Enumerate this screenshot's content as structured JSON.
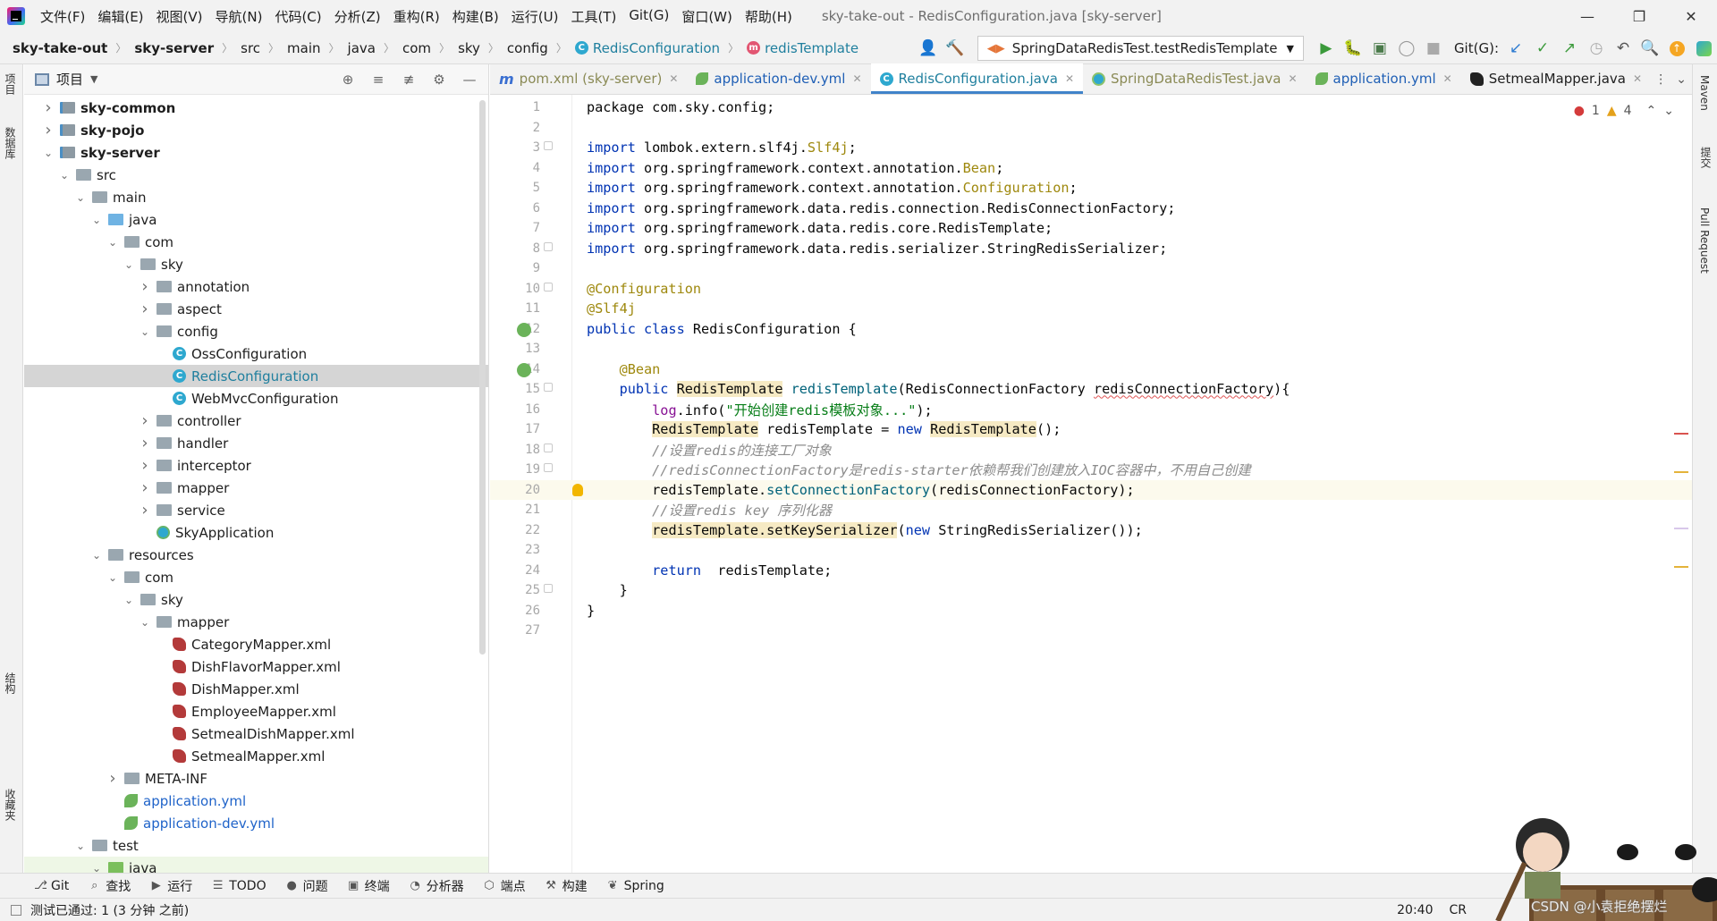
{
  "menubar": {
    "items": [
      "文件(F)",
      "编辑(E)",
      "视图(V)",
      "导航(N)",
      "代码(C)",
      "分析(Z)",
      "重构(R)",
      "构建(B)",
      "运行(U)",
      "工具(T)",
      "Git(G)",
      "窗口(W)",
      "帮助(H)"
    ],
    "window_title": "sky-take-out - RedisConfiguration.java [sky-server]"
  },
  "breadcrumb": {
    "items": [
      "sky-take-out",
      "sky-server",
      "src",
      "main",
      "java",
      "com",
      "sky",
      "config",
      "RedisConfiguration",
      "redisTemplate"
    ]
  },
  "toolbar": {
    "run_config": "SpringDataRedisTest.testRedisTemplate",
    "git_label": "Git(G):"
  },
  "left_strip": {
    "tabs": [
      "项目",
      "数据库",
      "结构",
      "收藏夹"
    ]
  },
  "project_panel": {
    "title": "项目",
    "tree": [
      {
        "depth": 0,
        "arrow": "right",
        "icon": "module",
        "label": "sky-common",
        "style": "bold"
      },
      {
        "depth": 0,
        "arrow": "right",
        "icon": "module",
        "label": "sky-pojo",
        "style": "bold"
      },
      {
        "depth": 0,
        "arrow": "down",
        "icon": "module",
        "label": "sky-server",
        "style": "bold"
      },
      {
        "depth": 1,
        "arrow": "down",
        "icon": "folder",
        "label": "src",
        "style": ""
      },
      {
        "depth": 2,
        "arrow": "down",
        "icon": "folder",
        "label": "main",
        "style": ""
      },
      {
        "depth": 3,
        "arrow": "down",
        "icon": "folder-blue",
        "label": "java",
        "style": ""
      },
      {
        "depth": 4,
        "arrow": "down",
        "icon": "folder",
        "label": "com",
        "style": ""
      },
      {
        "depth": 5,
        "arrow": "down",
        "icon": "folder",
        "label": "sky",
        "style": ""
      },
      {
        "depth": 6,
        "arrow": "right",
        "icon": "folder",
        "label": "annotation",
        "style": ""
      },
      {
        "depth": 6,
        "arrow": "right",
        "icon": "folder",
        "label": "aspect",
        "style": ""
      },
      {
        "depth": 6,
        "arrow": "down",
        "icon": "folder",
        "label": "config",
        "style": ""
      },
      {
        "depth": 7,
        "arrow": "",
        "icon": "class",
        "label": "OssConfiguration",
        "style": ""
      },
      {
        "depth": 7,
        "arrow": "",
        "icon": "class",
        "label": "RedisConfiguration",
        "style": "sel",
        "selected": true
      },
      {
        "depth": 7,
        "arrow": "",
        "icon": "class",
        "label": "WebMvcConfiguration",
        "style": ""
      },
      {
        "depth": 6,
        "arrow": "right",
        "icon": "folder",
        "label": "controller",
        "style": ""
      },
      {
        "depth": 6,
        "arrow": "right",
        "icon": "folder",
        "label": "handler",
        "style": ""
      },
      {
        "depth": 6,
        "arrow": "right",
        "icon": "folder",
        "label": "interceptor",
        "style": ""
      },
      {
        "depth": 6,
        "arrow": "right",
        "icon": "folder",
        "label": "mapper",
        "style": ""
      },
      {
        "depth": 6,
        "arrow": "right",
        "icon": "folder",
        "label": "service",
        "style": ""
      },
      {
        "depth": 6,
        "arrow": "",
        "icon": "app",
        "label": "SkyApplication",
        "style": ""
      },
      {
        "depth": 3,
        "arrow": "down",
        "icon": "folder",
        "label": "resources",
        "style": ""
      },
      {
        "depth": 4,
        "arrow": "down",
        "icon": "folder",
        "label": "com",
        "style": ""
      },
      {
        "depth": 5,
        "arrow": "down",
        "icon": "folder",
        "label": "sky",
        "style": ""
      },
      {
        "depth": 6,
        "arrow": "down",
        "icon": "folder",
        "label": "mapper",
        "style": ""
      },
      {
        "depth": 7,
        "arrow": "",
        "icon": "xml",
        "label": "CategoryMapper.xml",
        "style": ""
      },
      {
        "depth": 7,
        "arrow": "",
        "icon": "xml",
        "label": "DishFlavorMapper.xml",
        "style": ""
      },
      {
        "depth": 7,
        "arrow": "",
        "icon": "xml",
        "label": "DishMapper.xml",
        "style": ""
      },
      {
        "depth": 7,
        "arrow": "",
        "icon": "xml",
        "label": "EmployeeMapper.xml",
        "style": ""
      },
      {
        "depth": 7,
        "arrow": "",
        "icon": "xml",
        "label": "SetmealDishMapper.xml",
        "style": ""
      },
      {
        "depth": 7,
        "arrow": "",
        "icon": "xml",
        "label": "SetmealMapper.xml",
        "style": ""
      },
      {
        "depth": 4,
        "arrow": "right",
        "icon": "folder",
        "label": "META-INF",
        "style": ""
      },
      {
        "depth": 4,
        "arrow": "",
        "icon": "yml",
        "label": "application.yml",
        "style": "blue"
      },
      {
        "depth": 4,
        "arrow": "",
        "icon": "yml",
        "label": "application-dev.yml",
        "style": "blue"
      },
      {
        "depth": 2,
        "arrow": "down",
        "icon": "folder",
        "label": "test",
        "style": ""
      },
      {
        "depth": 3,
        "arrow": "down",
        "icon": "folder-green",
        "label": "java",
        "style": "",
        "testsel": true
      }
    ]
  },
  "editor": {
    "tabs": [
      {
        "label": "pom.xml (sky-server)",
        "icon": "maven",
        "cls": "dim",
        "active": false
      },
      {
        "label": "application-dev.yml",
        "icon": "yml",
        "cls": "yml",
        "active": false
      },
      {
        "label": "RedisConfiguration.java",
        "icon": "class",
        "cls": "java",
        "active": true
      },
      {
        "label": "SpringDataRedisTest.java",
        "icon": "test",
        "cls": "dim",
        "active": false
      },
      {
        "label": "application.yml",
        "icon": "yml",
        "cls": "yml",
        "active": false
      },
      {
        "label": "SetmealMapper.java",
        "icon": "xml",
        "cls": "",
        "active": false
      }
    ],
    "inspection": {
      "errors": "1",
      "warnings": "4"
    },
    "current_line": 20,
    "lines": [
      [
        {
          "t": "package com.sky.config;",
          "c": ""
        }
      ],
      [],
      [
        {
          "t": "import",
          "c": "kw"
        },
        {
          "t": " lombok.extern.slf4j.",
          "c": ""
        },
        {
          "t": "Slf4j",
          "c": "ann"
        },
        {
          "t": ";",
          "c": ""
        }
      ],
      [
        {
          "t": "import",
          "c": "kw"
        },
        {
          "t": " org.springframework.context.annotation.",
          "c": ""
        },
        {
          "t": "Bean",
          "c": "ann"
        },
        {
          "t": ";",
          "c": ""
        }
      ],
      [
        {
          "t": "import",
          "c": "kw"
        },
        {
          "t": " org.springframework.context.annotation.",
          "c": ""
        },
        {
          "t": "Configuration",
          "c": "ann"
        },
        {
          "t": ";",
          "c": ""
        }
      ],
      [
        {
          "t": "import",
          "c": "kw"
        },
        {
          "t": " org.springframework.data.redis.connection.RedisConnectionFactory;",
          "c": ""
        }
      ],
      [
        {
          "t": "import",
          "c": "kw"
        },
        {
          "t": " org.springframework.data.redis.core.RedisTemplate;",
          "c": ""
        }
      ],
      [
        {
          "t": "import",
          "c": "kw"
        },
        {
          "t": " org.springframework.data.redis.serializer.StringRedisSerializer;",
          "c": ""
        }
      ],
      [],
      [
        {
          "t": "@Configuration",
          "c": "ann"
        }
      ],
      [
        {
          "t": "@Slf4j",
          "c": "ann"
        }
      ],
      [
        {
          "t": "public class",
          "c": "kw"
        },
        {
          "t": " RedisConfiguration {",
          "c": ""
        }
      ],
      [],
      [
        {
          "t": "    ",
          "c": ""
        },
        {
          "t": "@Bean",
          "c": "ann"
        }
      ],
      [
        {
          "t": "    ",
          "c": ""
        },
        {
          "t": "public",
          "c": "kw"
        },
        {
          "t": " ",
          "c": ""
        },
        {
          "t": "RedisTemplate",
          "c": "hl"
        },
        {
          "t": " ",
          "c": ""
        },
        {
          "t": "redisTemplate",
          "c": "fn"
        },
        {
          "t": "(RedisConnectionFactory ",
          "c": ""
        },
        {
          "t": "redisConnectionFactory",
          "c": "und"
        },
        {
          "t": "){",
          "c": ""
        }
      ],
      [
        {
          "t": "        ",
          "c": ""
        },
        {
          "t": "log",
          "c": "fld"
        },
        {
          "t": ".info(",
          "c": ""
        },
        {
          "t": "\"开始创建redis模板对象...\"",
          "c": "str"
        },
        {
          "t": ");",
          "c": ""
        }
      ],
      [
        {
          "t": "        ",
          "c": ""
        },
        {
          "t": "RedisTemplate",
          "c": "hl"
        },
        {
          "t": " redisTemplate = ",
          "c": ""
        },
        {
          "t": "new",
          "c": "kw"
        },
        {
          "t": " ",
          "c": ""
        },
        {
          "t": "RedisTemplate",
          "c": "hl"
        },
        {
          "t": "();",
          "c": ""
        }
      ],
      [
        {
          "t": "        ",
          "c": ""
        },
        {
          "t": "//设置redis的连接工厂对象",
          "c": "cmt"
        }
      ],
      [
        {
          "t": "        ",
          "c": ""
        },
        {
          "t": "//redisConnectionFactory是redis-starter依赖帮我们创建放入IOC容器中，不用自己创建",
          "c": "cmt"
        }
      ],
      [
        {
          "t": "        redisTemplate.",
          "c": ""
        },
        {
          "t": "setConnectionFactory",
          "c": "fn"
        },
        {
          "t": "(redisConnectionFactory);",
          "c": ""
        }
      ],
      [
        {
          "t": "        ",
          "c": ""
        },
        {
          "t": "//设置redis key 序列化器",
          "c": "cmt"
        }
      ],
      [
        {
          "t": "        ",
          "c": ""
        },
        {
          "t": "redisTemplate.setKeySerializer",
          "c": "hl"
        },
        {
          "t": "(",
          "c": ""
        },
        {
          "t": "new",
          "c": "kw"
        },
        {
          "t": " StringRedisSerializer());",
          "c": ""
        }
      ],
      [],
      [
        {
          "t": "        ",
          "c": ""
        },
        {
          "t": "return",
          "c": "kw"
        },
        {
          "t": "  redisTemplate;",
          "c": ""
        }
      ],
      [
        {
          "t": "    }",
          "c": ""
        }
      ],
      [
        {
          "t": "}",
          "c": ""
        }
      ],
      []
    ]
  },
  "right_strip": {
    "tabs": [
      "Maven",
      "提交",
      "Pull Request"
    ]
  },
  "bottombar": {
    "items": [
      {
        "icon": "git-icon",
        "label": "Git"
      },
      {
        "icon": "search-icon",
        "label": "查找"
      },
      {
        "icon": "run-icon",
        "label": "运行"
      },
      {
        "icon": "todo-icon",
        "label": "TODO"
      },
      {
        "icon": "problems-icon",
        "label": "问题"
      },
      {
        "icon": "terminal-icon",
        "label": "终端"
      },
      {
        "icon": "profiler-icon",
        "label": "分析器"
      },
      {
        "icon": "endpoints-icon",
        "label": "端点"
      },
      {
        "icon": "build-icon",
        "label": "构建"
      },
      {
        "icon": "spring-icon",
        "label": "Spring"
      }
    ]
  },
  "statusbar": {
    "message": "测试已通过: 1 (3 分钟 之前)",
    "position": "20:40",
    "line_sep": "CR",
    "watermark": "CSDN @小袁拒绝摆烂"
  }
}
